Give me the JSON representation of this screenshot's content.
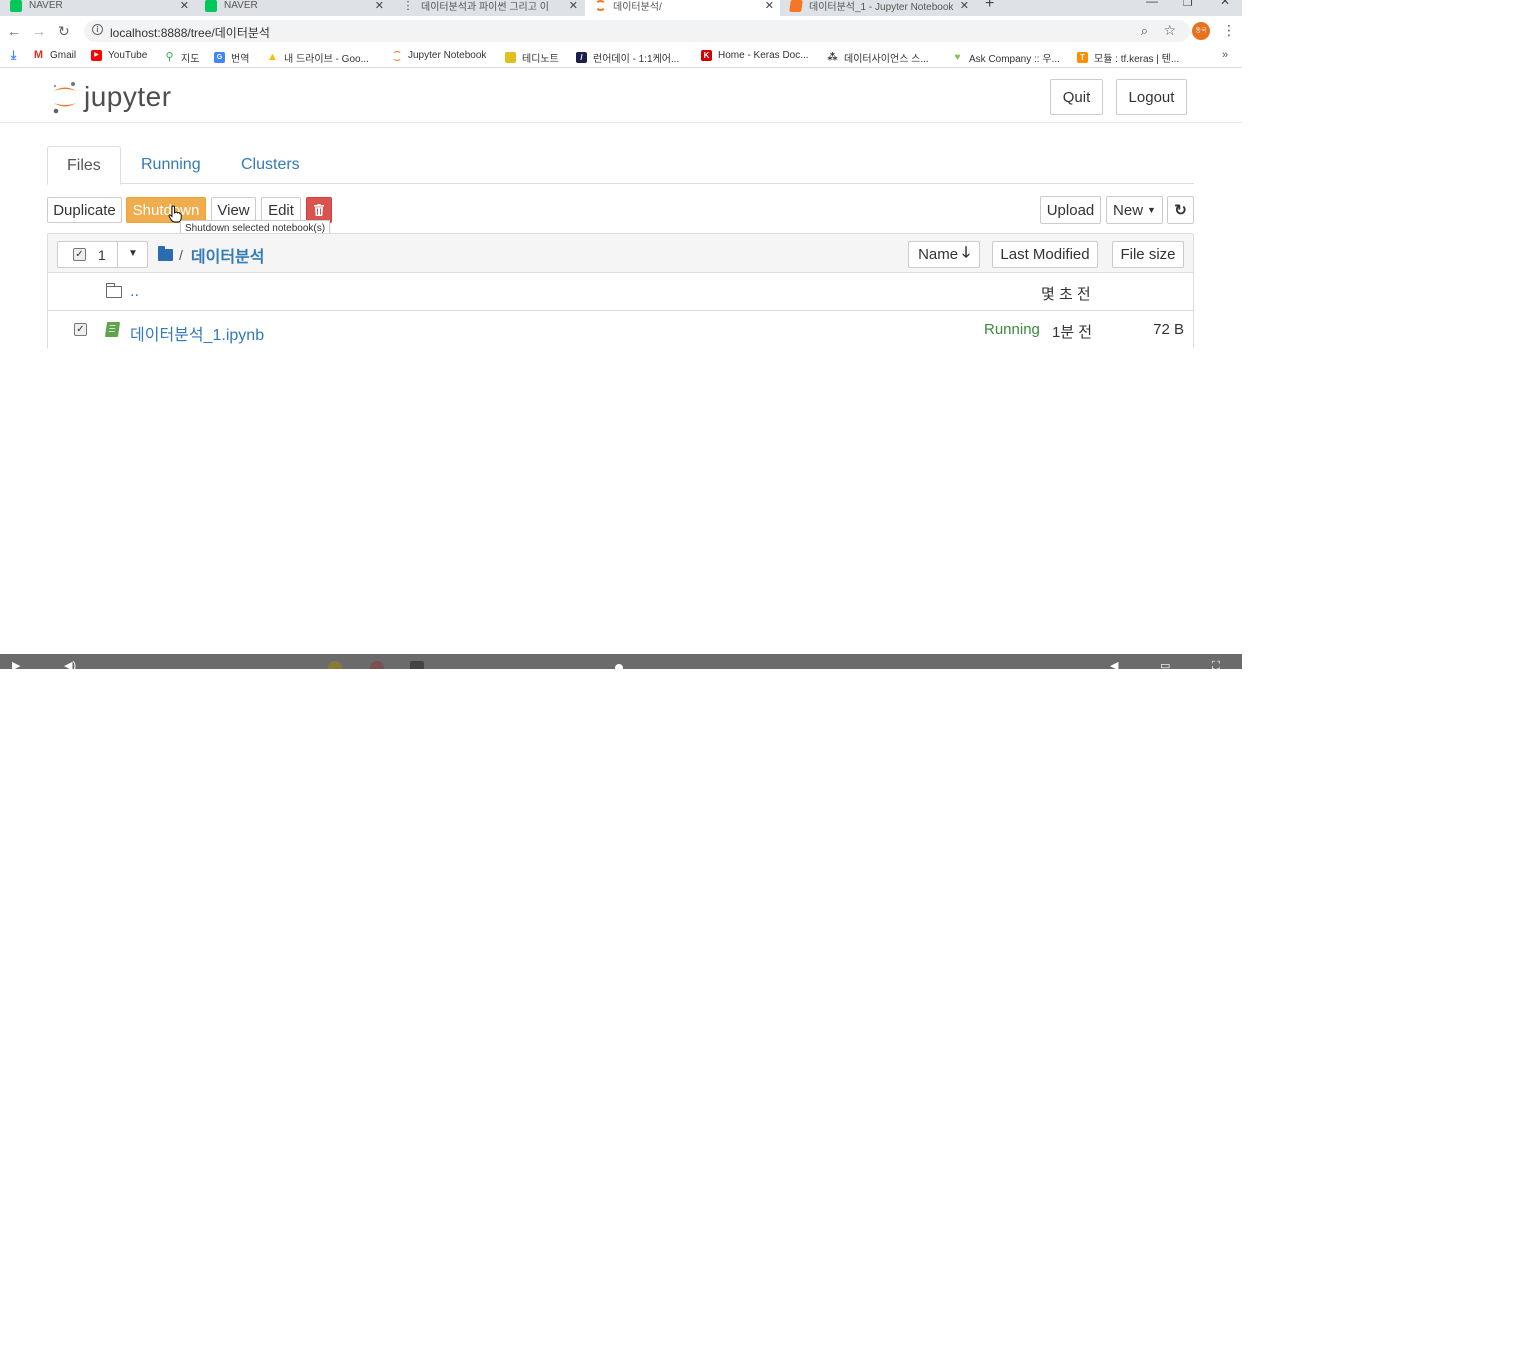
{
  "browser": {
    "tabs": [
      {
        "title": "NAVER",
        "favicon_color": "#03c75a"
      },
      {
        "title": "NAVER",
        "favicon_color": "#03c75a"
      },
      {
        "title": "데이터분석과 파이썬 그리고 이",
        "favicon_color": "#444444"
      },
      {
        "title": "데이터분석/",
        "favicon_color": "#f37726",
        "active": true
      },
      {
        "title": "데이터분석_1 - Jupyter Notebook",
        "favicon_color": "#f37726"
      }
    ],
    "url": "localhost:8888/tree/데이터분석",
    "profile_label": "동국",
    "bookmarks": [
      {
        "label": "Gmail",
        "icon": "gmail-icon",
        "color": "#d93025"
      },
      {
        "label": "YouTube",
        "icon": "youtube-icon",
        "color": "#ff0000"
      },
      {
        "label": "지도",
        "icon": "maps-icon",
        "color": "#34a853"
      },
      {
        "label": "번역",
        "icon": "translate-icon",
        "color": "#4285f4"
      },
      {
        "label": "내 드라이브 - Goo...",
        "icon": "drive-icon",
        "color": "#fbbc04"
      },
      {
        "label": "Jupyter Notebook",
        "icon": "jupyter-icon",
        "color": "#f37726"
      },
      {
        "label": "테디노트",
        "icon": "teddynote-icon",
        "color": "#e0c020"
      },
      {
        "label": "런어데이 - 1:1케어...",
        "icon": "learnaday-icon",
        "color": "#1a1f4d"
      },
      {
        "label": "Home - Keras Doc...",
        "icon": "keras-icon",
        "color": "#d00000"
      },
      {
        "label": "데이터사이언스 스...",
        "icon": "datascience-icon",
        "color": "#333333"
      },
      {
        "label": "Ask Company :: 우...",
        "icon": "askcompany-icon",
        "color": "#8bc34a"
      },
      {
        "label": "모듈 : tf.keras | 텐...",
        "icon": "tensorflow-icon",
        "color": "#ff8f00"
      }
    ],
    "bookmarks_more": "»"
  },
  "jupyter": {
    "logo_text": "jupyter",
    "quit_label": "Quit",
    "logout_label": "Logout",
    "tabs": [
      "Files",
      "Running",
      "Clusters"
    ],
    "toolbar": {
      "duplicate": "Duplicate",
      "shutdown": "Shutdown",
      "view": "View",
      "edit": "Edit",
      "upload": "Upload",
      "new": "New",
      "tooltip": "Shutdown selected notebook(s)"
    },
    "list": {
      "selected_count": "1",
      "breadcrumb_sep": "/",
      "current_dir": "데이터분석",
      "sort_name": "Name",
      "sort_modified": "Last Modified",
      "sort_size": "File size",
      "rows": [
        {
          "name": "..",
          "modified": "몇 초 전",
          "status": "",
          "size": "",
          "type": "folder"
        },
        {
          "name": "데이터분석_1.ipynb",
          "modified": "1분 전",
          "status": "Running",
          "size": "72 B",
          "type": "notebook",
          "checked": true
        }
      ]
    }
  },
  "colors": {
    "link": "#337ab7",
    "warning": "#f0ad4e",
    "danger": "#d9534f",
    "running": "#3c8a3c",
    "jupyter_orange": "#f37726"
  }
}
